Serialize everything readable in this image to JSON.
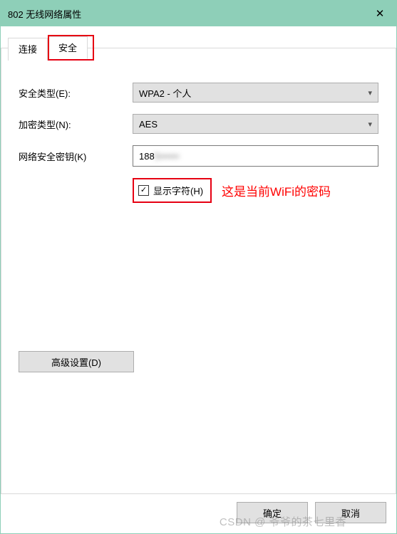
{
  "titlebar": {
    "title": "802 无线网络属性",
    "close": "✕"
  },
  "tabs": {
    "connection": "连接",
    "security": "安全"
  },
  "form": {
    "securityTypeLabel": "安全类型(E):",
    "securityTypeValue": "WPA2 - 个人",
    "encryptionLabel": "加密类型(N):",
    "encryptionValue": "AES",
    "keyLabel": "网络安全密钥(K)",
    "keyValuePrefix": "188",
    "keyValueHidden": "5••••••",
    "showCharsLabel": "显示字符(H)",
    "showCharsChecked": "✓"
  },
  "annotation": "这是当前WiFi的密码",
  "advanced": "高级设置(D)",
  "footer": {
    "ok": "确定",
    "cancel": "取消"
  },
  "watermark": "CSDN @ 爷爷的茶七里香"
}
